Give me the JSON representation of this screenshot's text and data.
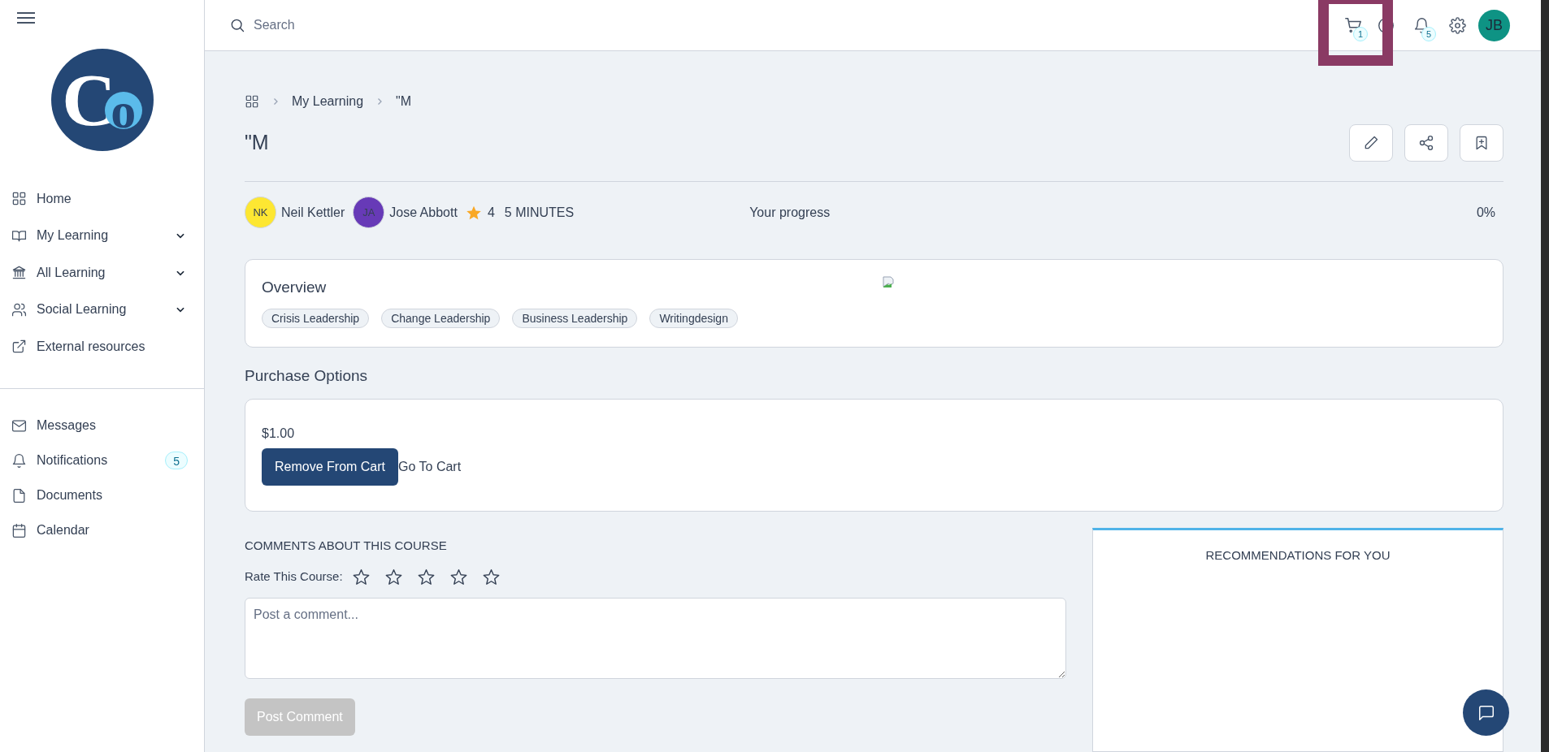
{
  "sidebar": {
    "logo": {
      "letters": [
        "C",
        "o"
      ]
    },
    "items": [
      {
        "label": "Home",
        "kind": "link"
      },
      {
        "label": "My Learning",
        "kind": "group",
        "expanded": false
      },
      {
        "label": "All Learning",
        "kind": "group",
        "expanded": false
      },
      {
        "label": "Social Learning",
        "kind": "group",
        "expanded": false
      },
      {
        "label": "External resources",
        "kind": "link"
      }
    ],
    "secondary_items": [
      {
        "label": "Messages"
      },
      {
        "label": "Notifications",
        "badge": "5"
      },
      {
        "label": "Documents"
      },
      {
        "label": "Calendar"
      }
    ]
  },
  "header": {
    "search": {
      "placeholder": "Search"
    },
    "cart_badge": "1",
    "notifications_badge": "5",
    "avatar": "JB"
  },
  "breadcrumb": [
    "My Learning",
    "\"M"
  ],
  "title": "\"M",
  "authors": [
    {
      "initials": "NK",
      "name": "Neil Kettler",
      "color": "#fde732"
    },
    {
      "initials": "JA",
      "name": "Jose Abbott",
      "color": "#673ab7"
    }
  ],
  "rating": "4",
  "duration": "5 MINUTES",
  "progress": {
    "label": "Your progress",
    "value": "0%"
  },
  "overview": {
    "title": "Overview",
    "tags": [
      "Crisis Leadership",
      "Change Leadership",
      "Business Leadership",
      "Writingdesign"
    ]
  },
  "purchase": {
    "title": "Purchase Options",
    "price": "$1.00",
    "primary_button": "Remove From Cart",
    "link": "Go To Cart"
  },
  "comments": {
    "title": "COMMENTS ABOUT THIS COURSE",
    "rate_label": "Rate This Course:",
    "stars": 0,
    "placeholder": "Post a comment...",
    "button": {
      "label": "Post Comment",
      "disabled": true
    }
  },
  "recommendations": {
    "title": "RECOMMENDATIONS FOR YOU"
  }
}
